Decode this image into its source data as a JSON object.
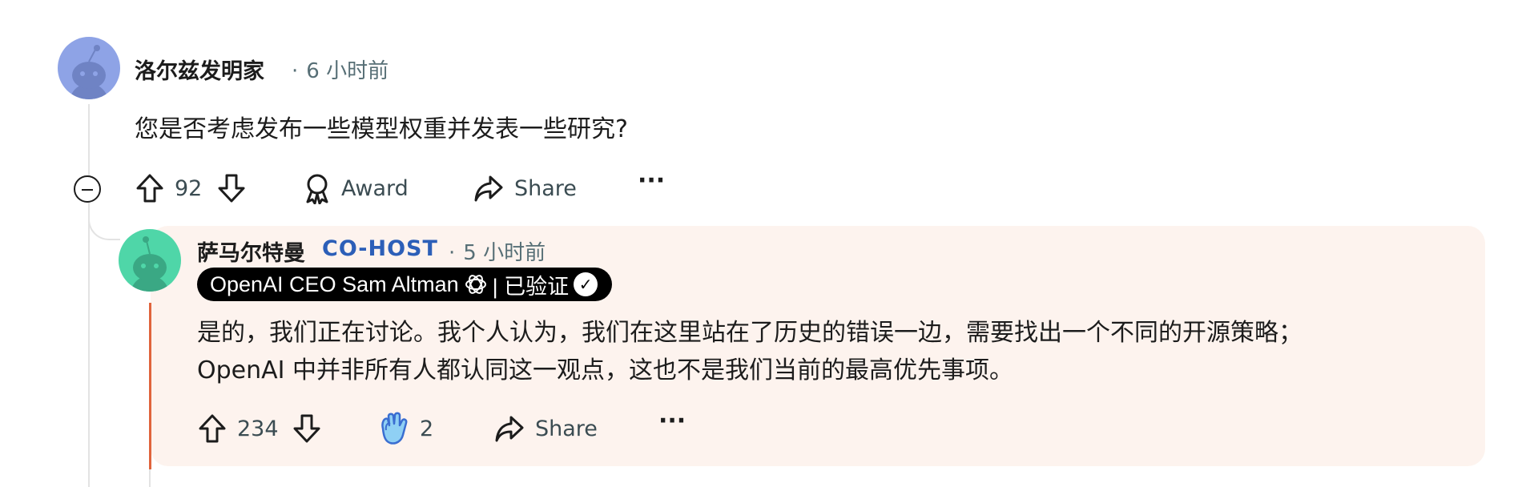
{
  "comment": {
    "author": "洛尔兹发明家",
    "time": "6 小时前",
    "body": "您是否考虑发布一些模型权重并发表一些研究?",
    "vote_count": "92",
    "award_label": "Award",
    "share_label": "Share",
    "more_label": "···"
  },
  "reply": {
    "author": "萨马尔特曼",
    "role_badge": "CO-HOST",
    "time": "5 小时前",
    "flair_text": "OpenAI CEO Sam Altman",
    "flair_verified": "| 已验证",
    "body_line1": "是的，我们正在讨论。我个人认为，我们在这里站在了历史的错误一边，需要找出一个不同的开源策略；",
    "body_line2": "OpenAI 中并非所有人都认同这一观点，这也不是我们当前的最高优先事项。",
    "vote_count": "234",
    "award_count": "2",
    "share_label": "Share",
    "more_label": "···"
  },
  "colors": {
    "accent_orange": "#e0643c",
    "cohost_blue": "#2c5fb8",
    "reply_bg": "#fdf3ee",
    "meta_gray": "#576f76"
  },
  "icons": [
    "snoo-avatar-icon",
    "collapse-icon",
    "upvote-icon",
    "downvote-icon",
    "award-icon",
    "share-icon",
    "more-icon",
    "openai-logo-icon",
    "verified-check-icon",
    "clapping-hands-award-icon"
  ]
}
